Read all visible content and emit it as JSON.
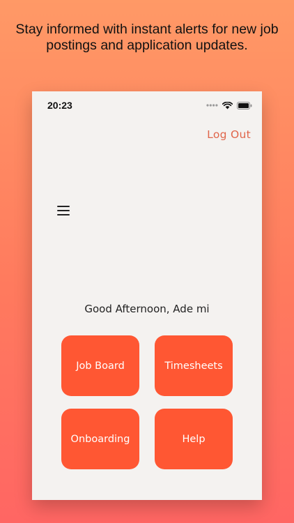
{
  "caption": "Stay informed with instant alerts for new job postings and application updates.",
  "status_bar": {
    "time": "20:23",
    "icons": [
      "signal-icon",
      "wifi-icon",
      "battery-icon"
    ]
  },
  "header": {
    "logout_label": "Log Out",
    "menu_icon": "hamburger-menu-icon"
  },
  "greeting": "Good Afternoon, Ade mi",
  "tiles": [
    {
      "label": "Job Board"
    },
    {
      "label": "Timesheets"
    },
    {
      "label": "Onboarding"
    },
    {
      "label": "Help"
    }
  ],
  "colors": {
    "background_top": "#FF9966",
    "background_bottom": "#FF6663",
    "screen": "#F4F2F0",
    "tile": "#FF5733",
    "tile_text": "#FFFFFF",
    "logout": "#E0654A"
  }
}
